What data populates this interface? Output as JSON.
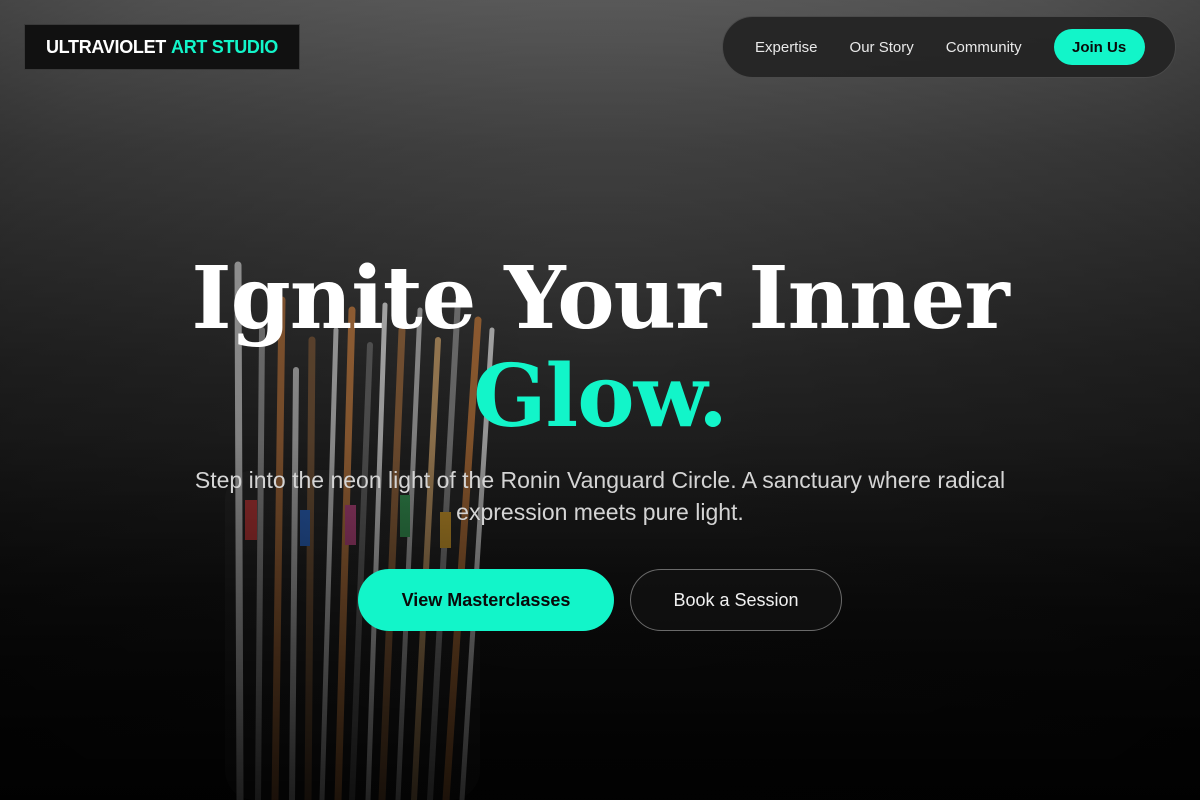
{
  "brand": {
    "name_main": "ULTRAVIOLET",
    "name_accent": "ART STUDIO",
    "accent_color": "#12f5c9"
  },
  "nav": {
    "links": [
      "Expertise",
      "Our Story",
      "Community"
    ],
    "cta_label": "Join Us"
  },
  "hero": {
    "headline_line1": "Ignite Your Inner",
    "headline_accent": "Glow.",
    "subtitle": "Step into the neon light of the Ronin Vanguard Circle. A sanctuary where radical expression meets pure light.",
    "primary_cta": "View Masterclasses",
    "secondary_cta": "Book a Session",
    "background_icon": "paintbrush-jar-photo"
  }
}
